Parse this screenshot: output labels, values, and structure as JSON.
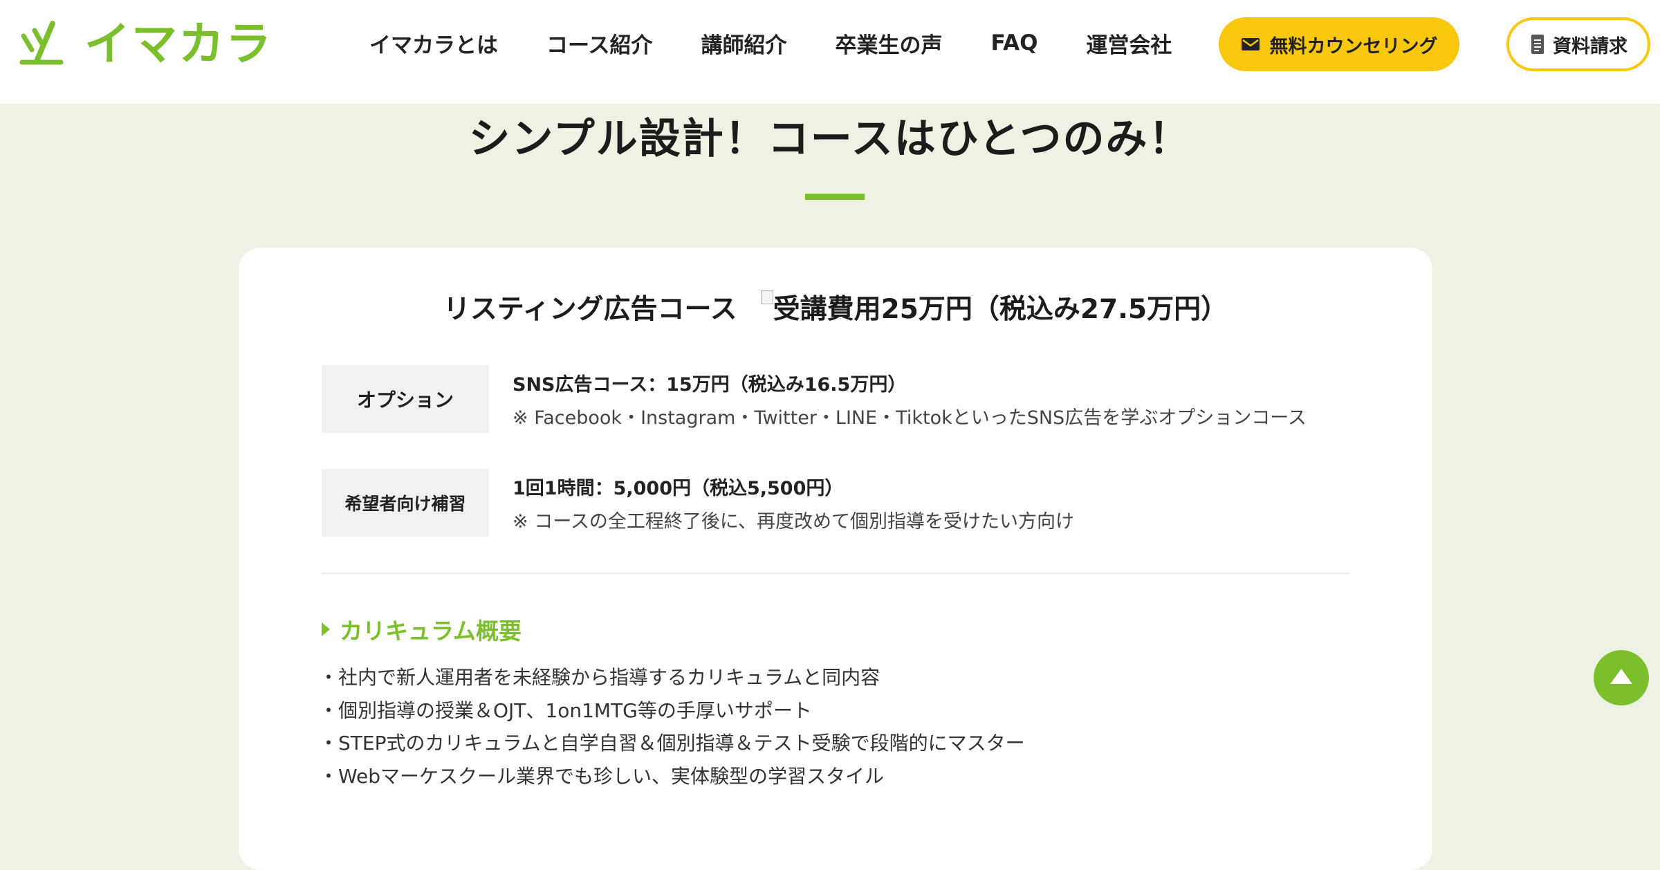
{
  "header": {
    "logo_text": "イマカラ",
    "nav": [
      "イマカラとは",
      "コース紹介",
      "講師紹介",
      "卒業生の声",
      "FAQ",
      "運営会社"
    ],
    "counsel_button": "無料カウンセリング",
    "docs_button": "資料請求"
  },
  "section": {
    "title": "シンプル設計！コースはひとつのみ！"
  },
  "course": {
    "name": "リスティング広告コース",
    "price": "受講費用25万円（税込み27.5万円）",
    "options": [
      {
        "label": "オプション",
        "head": "SNS広告コース：15万円（税込み16.5万円）",
        "desc": "※ Facebook・Instagram・Twitter・LINE・TiktokといったSNS広告を学ぶオプションコース"
      },
      {
        "label": "希望者向け補習",
        "head": "1回1時間：5,000円（税込5,500円）",
        "desc": "※ コースの全工程終了後に、再度改めて個別指導を受けたい方向け"
      }
    ],
    "curriculum_title": "カリキュラム概要",
    "curriculum": [
      "・社内で新人運用者を未経験から指導するカリキュラムと同内容",
      "・個別指導の授業＆OJT、1on1MTG等の手厚いサポート",
      "・STEP式のカリキュラムと自学自習＆個別指導＆テスト受験で段階的にマスター",
      "・Webマーケスクール業界でも珍しい、実体験型の学習スタイル"
    ]
  },
  "colors": {
    "brand_green": "#7bbf2d",
    "cta_yellow": "#f9c80e",
    "page_bg": "#eef2e3"
  },
  "icons": {
    "logo_mark": "stylized-check-icon",
    "counsel": "mail-icon",
    "docs": "document-icon",
    "to_top": "arrow-up-icon"
  }
}
